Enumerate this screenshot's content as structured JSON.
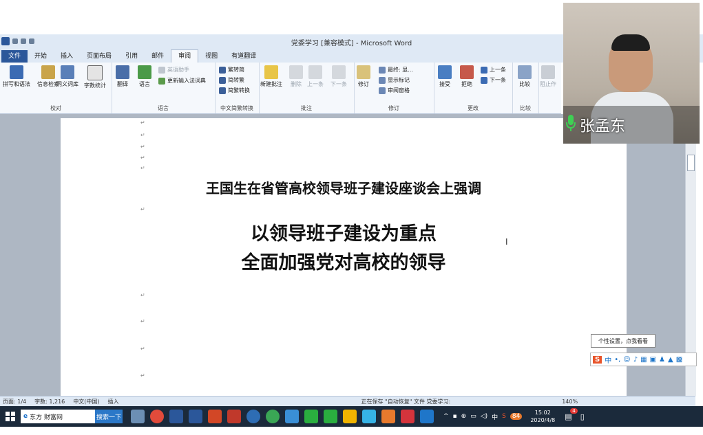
{
  "app": {
    "window_title": "党委学习 [兼容模式] - Microsoft Word"
  },
  "tabs": [
    "文件",
    "开始",
    "插入",
    "页面布局",
    "引用",
    "邮件",
    "审阅",
    "视图",
    "有道翻译"
  ],
  "active_tab": "审阅",
  "ribbon": {
    "groups": {
      "proofing": {
        "label": "校对",
        "buttons": [
          "拼写和语法",
          "信息检索",
          "同义词库",
          "字数统计"
        ]
      },
      "language": {
        "label": "语言",
        "buttons": [
          "翻译",
          "语言"
        ],
        "small": [
          "英语助手",
          "更新输入法词典"
        ]
      },
      "chinese_conversion": {
        "label": "中文简繁转换",
        "small": [
          "繁转简",
          "简转繁",
          "简繁转换"
        ]
      },
      "comments": {
        "label": "批注",
        "buttons": [
          "新建批注",
          "删除",
          "上一条",
          "下一条"
        ]
      },
      "tracking": {
        "label": "修订",
        "buttons": [
          "修订"
        ],
        "small": [
          "最终: 显...",
          "显示标记",
          "审阅窗格"
        ]
      },
      "changes": {
        "label": "更改",
        "buttons": [
          "接受",
          "拒绝"
        ],
        "small": [
          "上一条",
          "下一条"
        ]
      },
      "compare": {
        "label": "比较",
        "buttons": [
          "比较"
        ]
      },
      "protect": {
        "buttons": [
          "阻止作"
        ]
      }
    }
  },
  "document": {
    "heading1": "王国生在省管高校领导班子建设座谈会上强调",
    "heading2_line1": "以领导班子建设为重点",
    "heading2_line2": "全面加强党对高校的领导"
  },
  "status": {
    "page": "页面: 1/4",
    "words": "字数: 1,216",
    "language": "中文(中国)",
    "mode": "插入",
    "saving": "正在保存 \"自动恢复\" 文件 党委学习:",
    "zoom": "140%"
  },
  "taskbar": {
    "browser_tab": "东方 财富网",
    "search_button": "搜索一下",
    "time": "15:02",
    "date": "2020/4/8",
    "ime_indicator": "中",
    "notification_count": "4",
    "badge_84": "84"
  },
  "video": {
    "speaker_name": "张孟东"
  },
  "ime": {
    "tooltip": "个性设置，点我看看",
    "mode": "中"
  }
}
